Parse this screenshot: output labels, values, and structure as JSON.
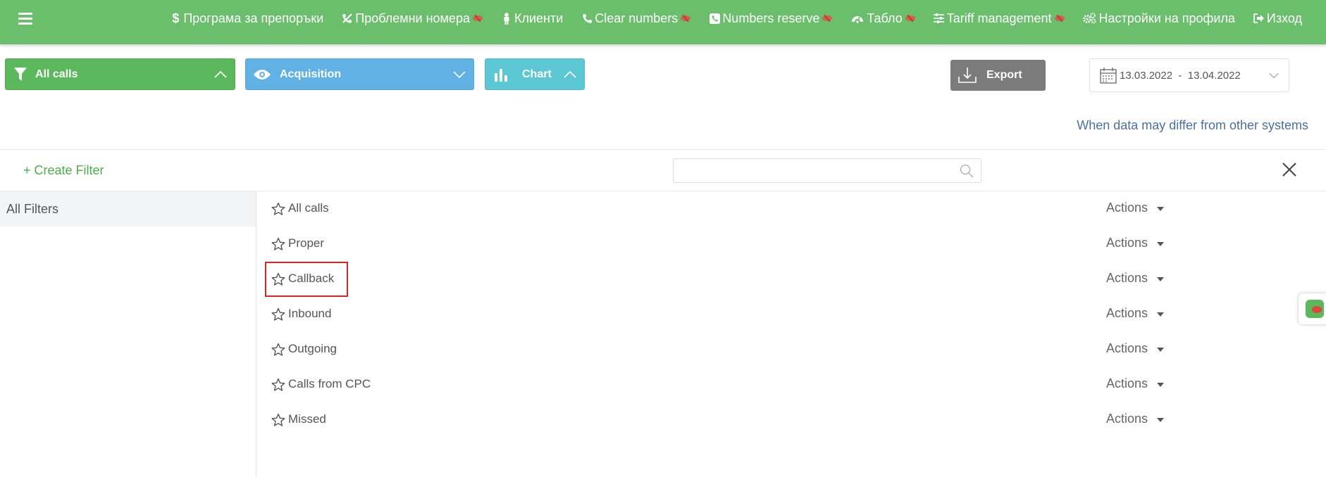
{
  "nav": {
    "items": [
      {
        "label": "Програма за препоръки",
        "icon": "dollar-icon",
        "hidden_marker": false
      },
      {
        "label": "Проблемни номера",
        "icon": "muted-phone-icon",
        "hidden_marker": true
      },
      {
        "label": "Клиенти",
        "icon": "user-icon",
        "hidden_marker": false
      },
      {
        "label": "Clear numbers",
        "icon": "phone-icon",
        "hidden_marker": true
      },
      {
        "label": "Numbers reserve",
        "icon": "phone-square-icon",
        "hidden_marker": true
      },
      {
        "label": "Табло",
        "icon": "dashboard-icon",
        "hidden_marker": true
      },
      {
        "label": "Tariff management",
        "icon": "sliders-icon",
        "hidden_marker": true
      },
      {
        "label": "Настройки на профила",
        "icon": "cogs-icon",
        "hidden_marker": false
      },
      {
        "label": "Изход",
        "icon": "sign-out-icon",
        "hidden_marker": false
      }
    ]
  },
  "toolbar": {
    "filter_dropdown": "All calls",
    "acquisition_dropdown": "Acquisition",
    "chart_dropdown": "Chart",
    "export_label": "Export",
    "date_range": "13.03.2022  -  13.04.2022"
  },
  "info_link": "When data may differ from other systems",
  "filters_panel": {
    "create_filter_label": "+ Create Filter",
    "search_placeholder": "",
    "sidebar": {
      "all_filters_label": "All Filters"
    },
    "rows": [
      {
        "name": "All calls",
        "actions_label": "Actions"
      },
      {
        "name": "Proper",
        "actions_label": "Actions"
      },
      {
        "name": "Callback",
        "actions_label": "Actions"
      },
      {
        "name": "Inbound",
        "actions_label": "Actions"
      },
      {
        "name": "Outgoing",
        "actions_label": "Actions"
      },
      {
        "name": "Calls from CPC",
        "actions_label": "Actions"
      },
      {
        "name": "Missed",
        "actions_label": "Actions"
      }
    ],
    "highlighted_row": "Callback"
  },
  "colors": {
    "topbar": "#6abe6c",
    "all_calls_button": "#5cb85c",
    "acquisition_button": "#62b1e4",
    "chart_button": "#5bc8d4",
    "export_button": "#7b7b7b",
    "highlight_border": "#e0211d",
    "link": "#4a6fa5"
  }
}
